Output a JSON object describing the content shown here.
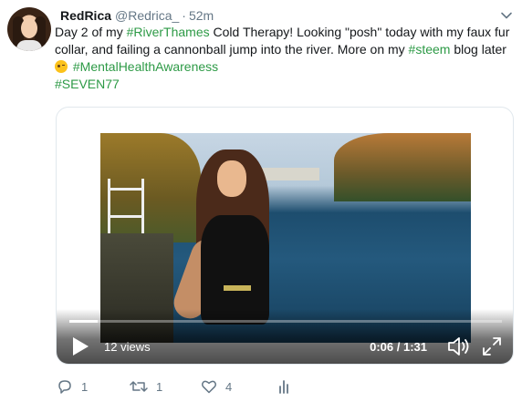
{
  "author": {
    "name": "RedRica",
    "handle": "@Redrica_",
    "separator": "·",
    "time": "52m"
  },
  "tweet": {
    "t1": "Day 2 of my ",
    "h1": "#RiverThames",
    "t2": " Cold Therapy! Looking \"posh\" today with my faux fur collar, and failing a cannonball jump into the river. More on my ",
    "h2": "#steem",
    "t3": " blog later ",
    "h3": "#MentalHealthAwareness",
    "h4": "#SEVEN77"
  },
  "video": {
    "views": "12 views",
    "timecode": "0:06 / 1:31",
    "progress": 0.066
  },
  "actions": {
    "reply_count": "1",
    "retweet_count": "1",
    "like_count": "4"
  },
  "colors": {
    "hashtag": "#2d9a46",
    "meta": "#657786",
    "text": "#14171a"
  },
  "icons": [
    "chevron-down-icon",
    "play-icon",
    "volume-icon",
    "fullscreen-icon",
    "reply-icon",
    "retweet-icon",
    "like-icon",
    "analytics-icon"
  ]
}
